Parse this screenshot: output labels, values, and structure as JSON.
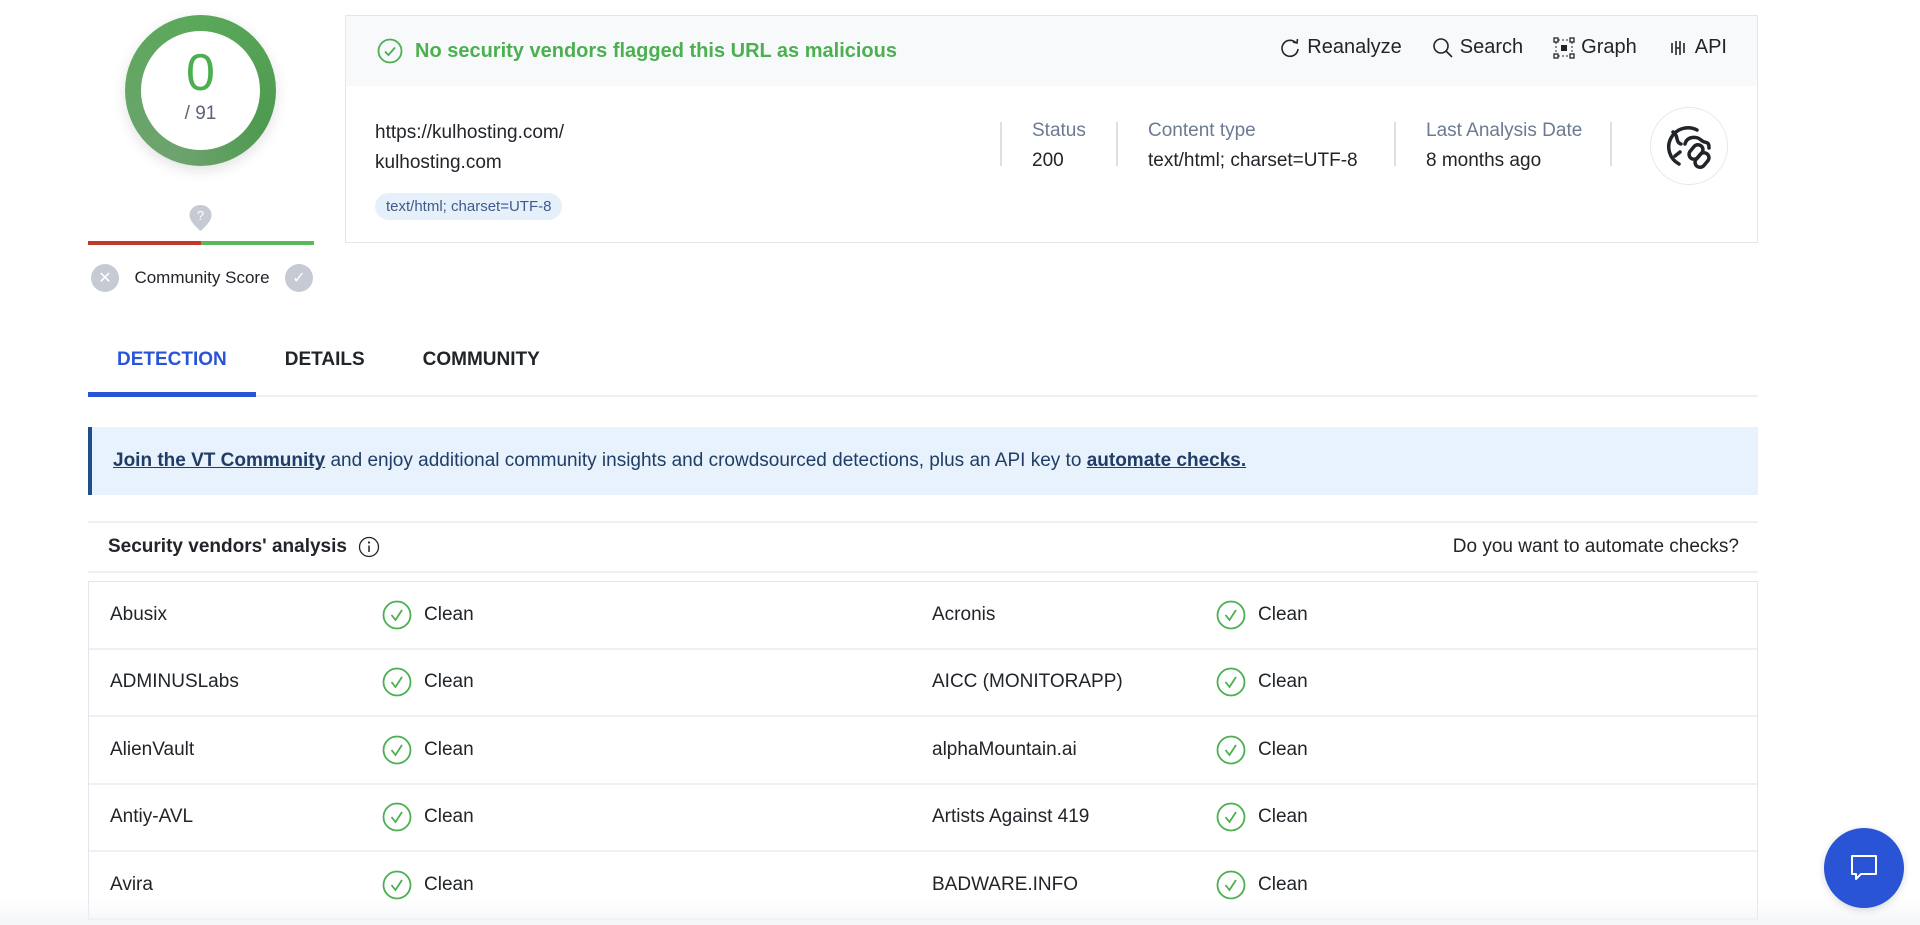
{
  "score": {
    "detections": "0",
    "total": "/ 91",
    "community_label": "Community Score",
    "colors": {
      "clean": "#4caf50",
      "negative": "#c0392b",
      "accent": "#2a54d6"
    }
  },
  "summary": {
    "verdict": "No security vendors flagged this URL as malicious",
    "actions": [
      {
        "label": "Reanalyze",
        "icon": "reanalyze-icon"
      },
      {
        "label": "Search",
        "icon": "search-icon"
      },
      {
        "label": "Graph",
        "icon": "graph-icon"
      },
      {
        "label": "API",
        "icon": "api-icon"
      }
    ],
    "url": "https://kulhosting.com/",
    "domain": "kulhosting.com",
    "tag": "text/html; charset=UTF-8",
    "meta": [
      {
        "label": "Status",
        "value": "200"
      },
      {
        "label": "Content type",
        "value": "text/html; charset=UTF-8"
      },
      {
        "label": "Last Analysis Date",
        "value": "8 months ago"
      }
    ]
  },
  "tabs": [
    {
      "label": "DETECTION",
      "active": true
    },
    {
      "label": "DETAILS",
      "active": false
    },
    {
      "label": "COMMUNITY",
      "active": false
    }
  ],
  "banner": {
    "link1": "Join the VT Community",
    "text": " and enjoy additional community insights and crowdsourced detections, plus an API key to ",
    "link2": "automate checks."
  },
  "vendors_section": {
    "title": "Security vendors' analysis",
    "automate_link": "Do you want to automate checks?"
  },
  "vendors": [
    {
      "left": {
        "name": "Abusix",
        "result": "Clean"
      },
      "right": {
        "name": "Acronis",
        "result": "Clean"
      }
    },
    {
      "left": {
        "name": "ADMINUSLabs",
        "result": "Clean"
      },
      "right": {
        "name": "AICC (MONITORAPP)",
        "result": "Clean"
      }
    },
    {
      "left": {
        "name": "AlienVault",
        "result": "Clean"
      },
      "right": {
        "name": "alphaMountain.ai",
        "result": "Clean"
      }
    },
    {
      "left": {
        "name": "Antiy-AVL",
        "result": "Clean"
      },
      "right": {
        "name": "Artists Against 419",
        "result": "Clean"
      }
    },
    {
      "left": {
        "name": "Avira",
        "result": "Clean"
      },
      "right": {
        "name": "BADWARE.INFO",
        "result": "Clean"
      }
    }
  ]
}
